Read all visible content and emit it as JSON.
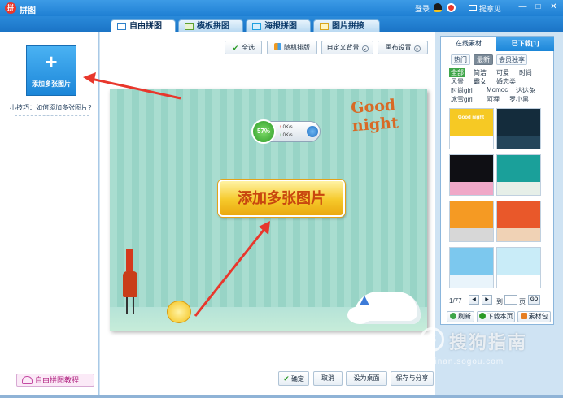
{
  "window": {
    "title": "拼图",
    "login": "登录",
    "feedback": "提意见",
    "controls": [
      "—",
      "□",
      "✕"
    ]
  },
  "tabs": [
    {
      "label": "自由拼图",
      "active": true
    },
    {
      "label": "模板拼图",
      "active": false
    },
    {
      "label": "海报拼图",
      "active": false
    },
    {
      "label": "图片拼接",
      "active": false
    }
  ],
  "left_panel": {
    "add_button_icon": "+",
    "add_button_label": "添加多张图片",
    "tip": "小技巧：如何添加多张图片?",
    "tutorial_label": "自由拼图教程"
  },
  "toolbar": {
    "select_all": "全选",
    "random": "随机排版",
    "custom_bg": "自定义背景",
    "canvas_settings": "画布设置"
  },
  "canvas": {
    "goodnight": "Good night",
    "speed_percent": "57%",
    "upload_speed": "0K/s",
    "download_speed": "0K/s",
    "big_button": "添加多张图片"
  },
  "bottom": {
    "confirm": "确定",
    "cancel": "取消",
    "set_wallpaper": "设为桌面",
    "save_share": "保存与分享"
  },
  "right_panel": {
    "tab_online": "在线素材",
    "tab_downloaded": "已下载[1]",
    "pills": [
      "热门",
      "最新",
      "会员独享"
    ],
    "categories": [
      "全部",
      "简洁",
      "可爱",
      "时尚",
      "风景",
      "霸女",
      "婚恋类",
      "时尚girl",
      "Momoc",
      "达达兔",
      "冰雪girl",
      "阿狸",
      "罗小黑"
    ],
    "pager": {
      "current": "1/77",
      "goto": "到",
      "page": "页",
      "go": "GO"
    },
    "buttons": {
      "refresh": "刷新",
      "download_page": "下载本页",
      "library": "素材包"
    },
    "thumb_text": "Good night"
  },
  "watermark": {
    "logo": "S",
    "text": "搜狗指南",
    "url": "zhinan.sogou.com"
  },
  "colors": {
    "accent": "#1e7fd3",
    "button_yellow": "#f6c92b",
    "arrow_red": "#e8372c"
  }
}
